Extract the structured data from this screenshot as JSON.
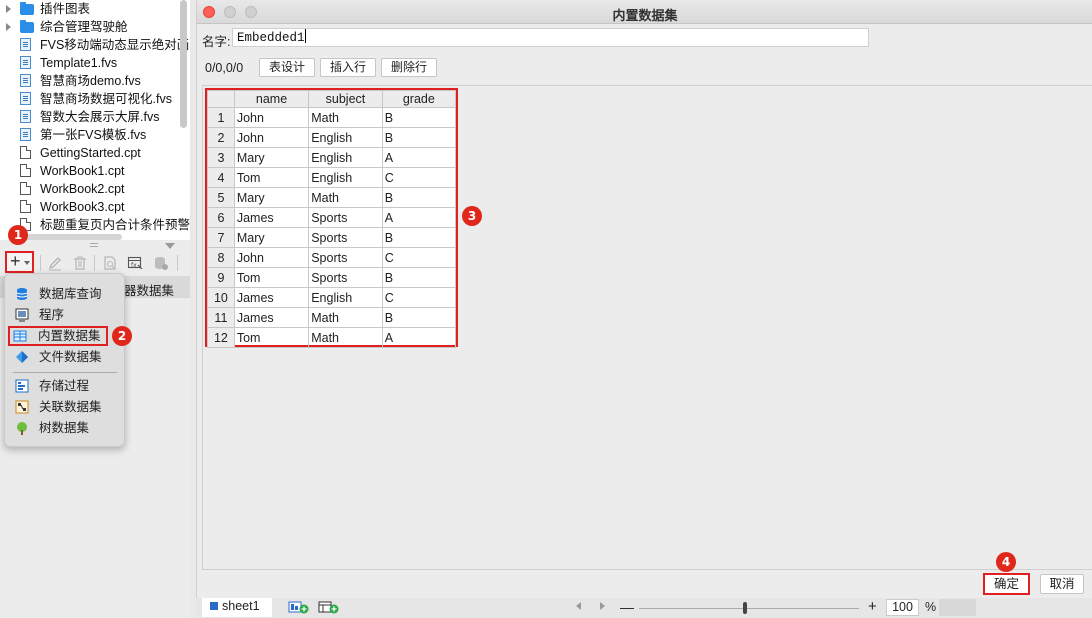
{
  "file_tree": {
    "items": [
      {
        "type": "folder",
        "label": "插件图表"
      },
      {
        "type": "folder",
        "label": "综合管理驾驶舱"
      },
      {
        "type": "fvs",
        "label": "FVS移动端动态显示绝对画"
      },
      {
        "type": "fvs",
        "label": "Template1.fvs"
      },
      {
        "type": "fvs",
        "label": "智慧商场demo.fvs"
      },
      {
        "type": "fvs",
        "label": "智慧商场数据可视化.fvs"
      },
      {
        "type": "fvs",
        "label": "智数大会展示大屏.fvs"
      },
      {
        "type": "fvs",
        "label": "第一张FVS模板.fvs"
      },
      {
        "type": "cpt",
        "label": "GettingStarted.cpt"
      },
      {
        "type": "cpt",
        "label": "WorkBook1.cpt"
      },
      {
        "type": "cpt",
        "label": "WorkBook2.cpt"
      },
      {
        "type": "cpt",
        "label": "WorkBook3.cpt"
      },
      {
        "type": "cpt",
        "label": "标题重复页内合计条件预警"
      }
    ]
  },
  "toolbar": {
    "add_glyph": "+",
    "icons": [
      "add-icon",
      "edit-icon",
      "delete-icon",
      "preview-icon",
      "dataset-params-icon",
      "server-dataset-icon"
    ]
  },
  "dataset_row": {
    "label": "器数据集"
  },
  "markers": [
    "1",
    "2",
    "3",
    "4"
  ],
  "menu": {
    "items": [
      {
        "icon": "database-query-icon",
        "label": "数据库查询"
      },
      {
        "icon": "program-icon",
        "label": "程序"
      },
      {
        "icon": "embedded-dataset-icon",
        "label": "内置数据集"
      },
      {
        "icon": "file-dataset-icon",
        "label": "文件数据集"
      },
      {
        "icon": "stored-procedure-icon",
        "label": "存储过程"
      },
      {
        "icon": "related-dataset-icon",
        "label": "关联数据集"
      },
      {
        "icon": "tree-dataset-icon",
        "label": "树数据集"
      }
    ]
  },
  "dialog": {
    "title": "内置数据集",
    "name_label": "名字:",
    "name_value": "Embedded1",
    "position": "0/0,0/0",
    "buttons": {
      "design": "表设计",
      "insert_row": "插入行",
      "delete_row": "删除行"
    },
    "ok": "确定",
    "cancel": "取消"
  },
  "table": {
    "columns": [
      "name",
      "subject",
      "grade"
    ],
    "rows": [
      [
        "1",
        "John",
        "Math",
        "B"
      ],
      [
        "2",
        "John",
        "English",
        "B"
      ],
      [
        "3",
        "Mary",
        "English",
        "A"
      ],
      [
        "4",
        "Tom",
        "English",
        "C"
      ],
      [
        "5",
        "Mary",
        "Math",
        "B"
      ],
      [
        "6",
        "James",
        "Sports",
        "A"
      ],
      [
        "7",
        "Mary",
        "Sports",
        "B"
      ],
      [
        "8",
        "John",
        "Sports",
        "C"
      ],
      [
        "9",
        "Tom",
        "Sports",
        "B"
      ],
      [
        "10",
        "James",
        "English",
        "C"
      ],
      [
        "11",
        "James",
        "Math",
        "B"
      ],
      [
        "12",
        "Tom",
        "Math",
        "A"
      ]
    ]
  },
  "statusbar": {
    "sheet_tab": "sheet1",
    "zoom_minus": "—",
    "zoom_plus": "+",
    "zoom_value": "100",
    "zoom_unit": "%"
  },
  "colors": {
    "highlight": "#e02020",
    "marker": "#e0271c",
    "folder": "#2a8ee8",
    "close_light": "#fe5f57"
  }
}
